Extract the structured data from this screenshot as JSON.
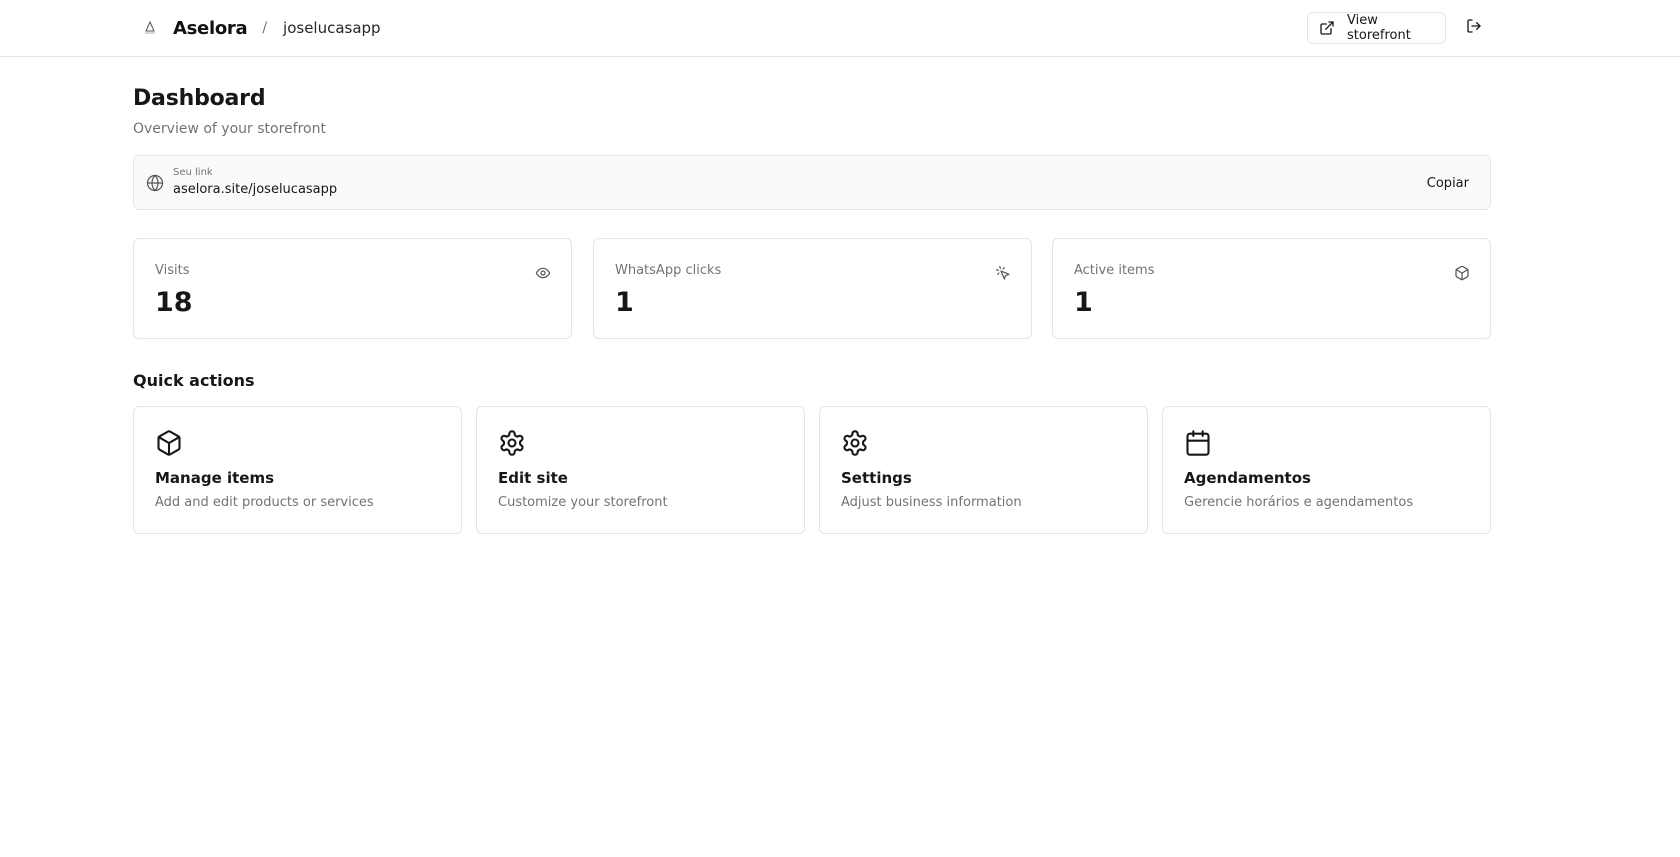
{
  "header": {
    "brand": "Aselora",
    "separator": "/",
    "username": "joselucasapp",
    "view_storefront_label": "View storefront",
    "icons": {
      "logo": "aselora-logo-icon",
      "external_link": "external-link-icon",
      "logout": "logout-icon"
    }
  },
  "page": {
    "title": "Dashboard",
    "subtitle": "Overview of your storefront"
  },
  "link_bar": {
    "label": "Seu link",
    "url": "aselora.site/joselucasapp",
    "copy_label": "Copiar",
    "icon": "globe-icon"
  },
  "stats": [
    {
      "label": "Visits",
      "value": "18",
      "icon": "eye-icon"
    },
    {
      "label": "WhatsApp clicks",
      "value": "1",
      "icon": "pointer-click-icon"
    },
    {
      "label": "Active items",
      "value": "1",
      "icon": "package-icon"
    }
  ],
  "quick_actions": {
    "title": "Quick actions",
    "items": [
      {
        "title": "Manage items",
        "description": "Add and edit products or services",
        "icon": "package-icon"
      },
      {
        "title": "Edit site",
        "description": "Customize your storefront",
        "icon": "gear-icon"
      },
      {
        "title": "Settings",
        "description": "Adjust business information",
        "icon": "gear-icon"
      },
      {
        "title": "Agendamentos",
        "description": "Gerencie horários e agendamentos",
        "icon": "calendar-icon"
      }
    ]
  },
  "colors": {
    "text_primary": "#171717",
    "text_muted": "#737373",
    "border": "#e5e5e5",
    "link_bar_bg": "#fafafa"
  }
}
